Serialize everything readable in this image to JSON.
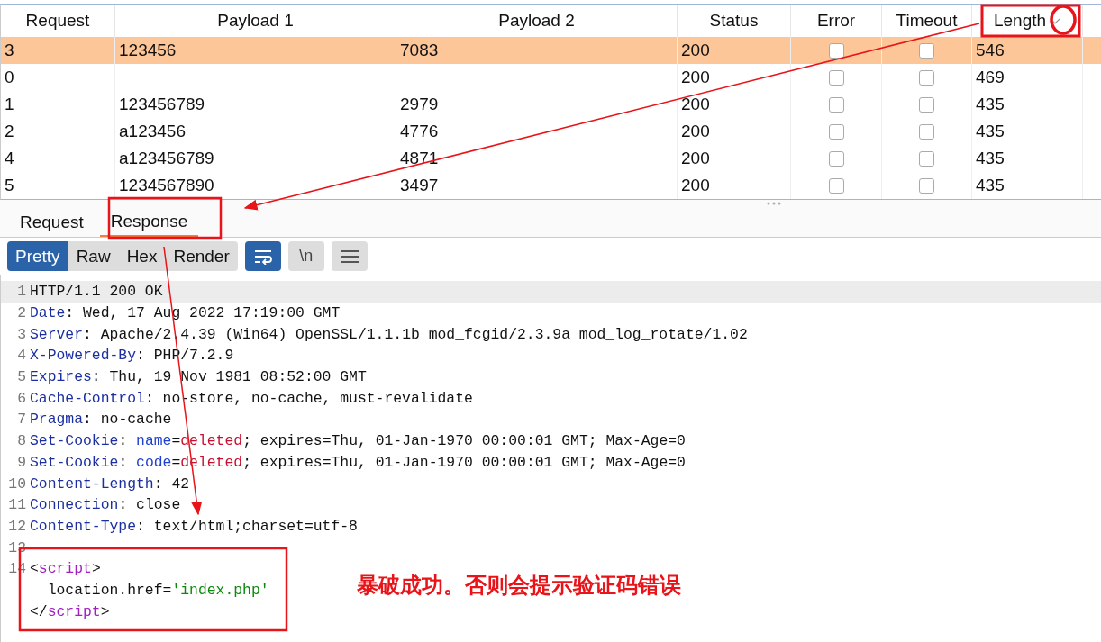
{
  "results_table": {
    "columns": [
      {
        "label": "Request",
        "sort_indicator": false
      },
      {
        "label": "Payload 1",
        "sort_indicator": false
      },
      {
        "label": "Payload 2",
        "sort_indicator": false
      },
      {
        "label": "Status",
        "sort_indicator": false
      },
      {
        "label": "Error",
        "sort_indicator": false
      },
      {
        "label": "Timeout",
        "sort_indicator": false
      },
      {
        "label": "Length",
        "sort_indicator": true
      }
    ],
    "rows": [
      {
        "request": "3",
        "payload_1": "123456",
        "payload_2": "7083",
        "status": "200",
        "error": false,
        "timeout": false,
        "length": "546",
        "selected": true
      },
      {
        "request": "0",
        "payload_1": "",
        "payload_2": "",
        "status": "200",
        "error": false,
        "timeout": false,
        "length": "469",
        "selected": false
      },
      {
        "request": "1",
        "payload_1": "123456789",
        "payload_2": "2979",
        "status": "200",
        "error": false,
        "timeout": false,
        "length": "435",
        "selected": false
      },
      {
        "request": "2",
        "payload_1": "a123456",
        "payload_2": "4776",
        "status": "200",
        "error": false,
        "timeout": false,
        "length": "435",
        "selected": false
      },
      {
        "request": "4",
        "payload_1": "a123456789",
        "payload_2": "4871",
        "status": "200",
        "error": false,
        "timeout": false,
        "length": "435",
        "selected": false
      },
      {
        "request": "5",
        "payload_1": "1234567890",
        "payload_2": "3497",
        "status": "200",
        "error": false,
        "timeout": false,
        "length": "435",
        "selected": false
      }
    ]
  },
  "message_tabs": [
    {
      "label": "Request",
      "selected": false
    },
    {
      "label": "Response",
      "selected": true
    }
  ],
  "view_toolbar": {
    "modes": [
      {
        "label": "Pretty",
        "selected": true
      },
      {
        "label": "Raw",
        "selected": false
      },
      {
        "label": "Hex",
        "selected": false
      },
      {
        "label": "Render",
        "selected": false
      }
    ],
    "tools": [
      {
        "kind": "wrap",
        "on": true
      },
      {
        "kind": "newline",
        "label": "\\n",
        "on": false
      },
      {
        "kind": "menu",
        "on": false
      }
    ]
  },
  "response_lines": [
    {
      "number": "1",
      "selected": true,
      "segments": [
        {
          "kind": "text",
          "text": "HTTP/1.1 200 OK"
        }
      ]
    },
    {
      "number": "2",
      "selected": false,
      "segments": [
        {
          "kind": "key",
          "text": "Date"
        },
        {
          "kind": "text",
          "text": ": Wed, 17 Aug 2022 17:19:00 GMT"
        }
      ]
    },
    {
      "number": "3",
      "selected": false,
      "segments": [
        {
          "kind": "key",
          "text": "Server"
        },
        {
          "kind": "text",
          "text": ": Apache/2.4.39 (Win64) OpenSSL/1.1.1b mod_fcgid/2.3.9a mod_log_rotate/1.02"
        }
      ]
    },
    {
      "number": "4",
      "selected": false,
      "segments": [
        {
          "kind": "key",
          "text": "X-Powered-By"
        },
        {
          "kind": "text",
          "text": ": PHP/7.2.9"
        }
      ]
    },
    {
      "number": "5",
      "selected": false,
      "segments": [
        {
          "kind": "key",
          "text": "Expires"
        },
        {
          "kind": "text",
          "text": ": Thu, 19 Nov 1981 08:52:00 GMT"
        }
      ]
    },
    {
      "number": "6",
      "selected": false,
      "segments": [
        {
          "kind": "key",
          "text": "Cache-Control"
        },
        {
          "kind": "text",
          "text": ": no-store, no-cache, must-revalidate"
        }
      ]
    },
    {
      "number": "7",
      "selected": false,
      "segments": [
        {
          "kind": "key",
          "text": "Pragma"
        },
        {
          "kind": "text",
          "text": ": no-cache"
        }
      ]
    },
    {
      "number": "8",
      "selected": false,
      "segments": [
        {
          "kind": "key",
          "text": "Set-Cookie"
        },
        {
          "kind": "text",
          "text": ": "
        },
        {
          "kind": "attr",
          "text": "name"
        },
        {
          "kind": "text",
          "text": "="
        },
        {
          "kind": "value",
          "text": "deleted"
        },
        {
          "kind": "text",
          "text": "; expires=Thu, 01-Jan-1970 00:00:01 GMT; Max-Age=0"
        }
      ]
    },
    {
      "number": "9",
      "selected": false,
      "segments": [
        {
          "kind": "key",
          "text": "Set-Cookie"
        },
        {
          "kind": "text",
          "text": ": "
        },
        {
          "kind": "attr",
          "text": "code"
        },
        {
          "kind": "text",
          "text": "="
        },
        {
          "kind": "value",
          "text": "deleted"
        },
        {
          "kind": "text",
          "text": "; expires=Thu, 01-Jan-1970 00:00:01 GMT; Max-Age=0"
        }
      ]
    },
    {
      "number": "10",
      "selected": false,
      "segments": [
        {
          "kind": "key",
          "text": "Content-Length"
        },
        {
          "kind": "text",
          "text": ": 42"
        }
      ]
    },
    {
      "number": "11",
      "selected": false,
      "segments": [
        {
          "kind": "key",
          "text": "Connection"
        },
        {
          "kind": "text",
          "text": ": close"
        }
      ]
    },
    {
      "number": "12",
      "selected": false,
      "segments": [
        {
          "kind": "key",
          "text": "Content-Type"
        },
        {
          "kind": "text",
          "text": ": text/html;charset=utf-8"
        }
      ]
    },
    {
      "number": "13",
      "selected": false
    },
    {
      "number": "14",
      "selected": false,
      "segments": [
        {
          "kind": "text",
          "text": "<"
        },
        {
          "kind": "tag",
          "text": "script"
        },
        {
          "kind": "text",
          "text": ">"
        }
      ]
    },
    {
      "selected": false,
      "segments": [
        {
          "kind": "text",
          "text": "  location.href="
        },
        {
          "kind": "string",
          "text": "'index.php'"
        }
      ]
    },
    {
      "selected": false,
      "segments": [
        {
          "kind": "text",
          "text": "</"
        },
        {
          "kind": "tag",
          "text": "script"
        },
        {
          "kind": "text",
          "text": ">"
        }
      ]
    }
  ],
  "annotation": {
    "note": "暴破成功。否则会提示验证码错误"
  }
}
